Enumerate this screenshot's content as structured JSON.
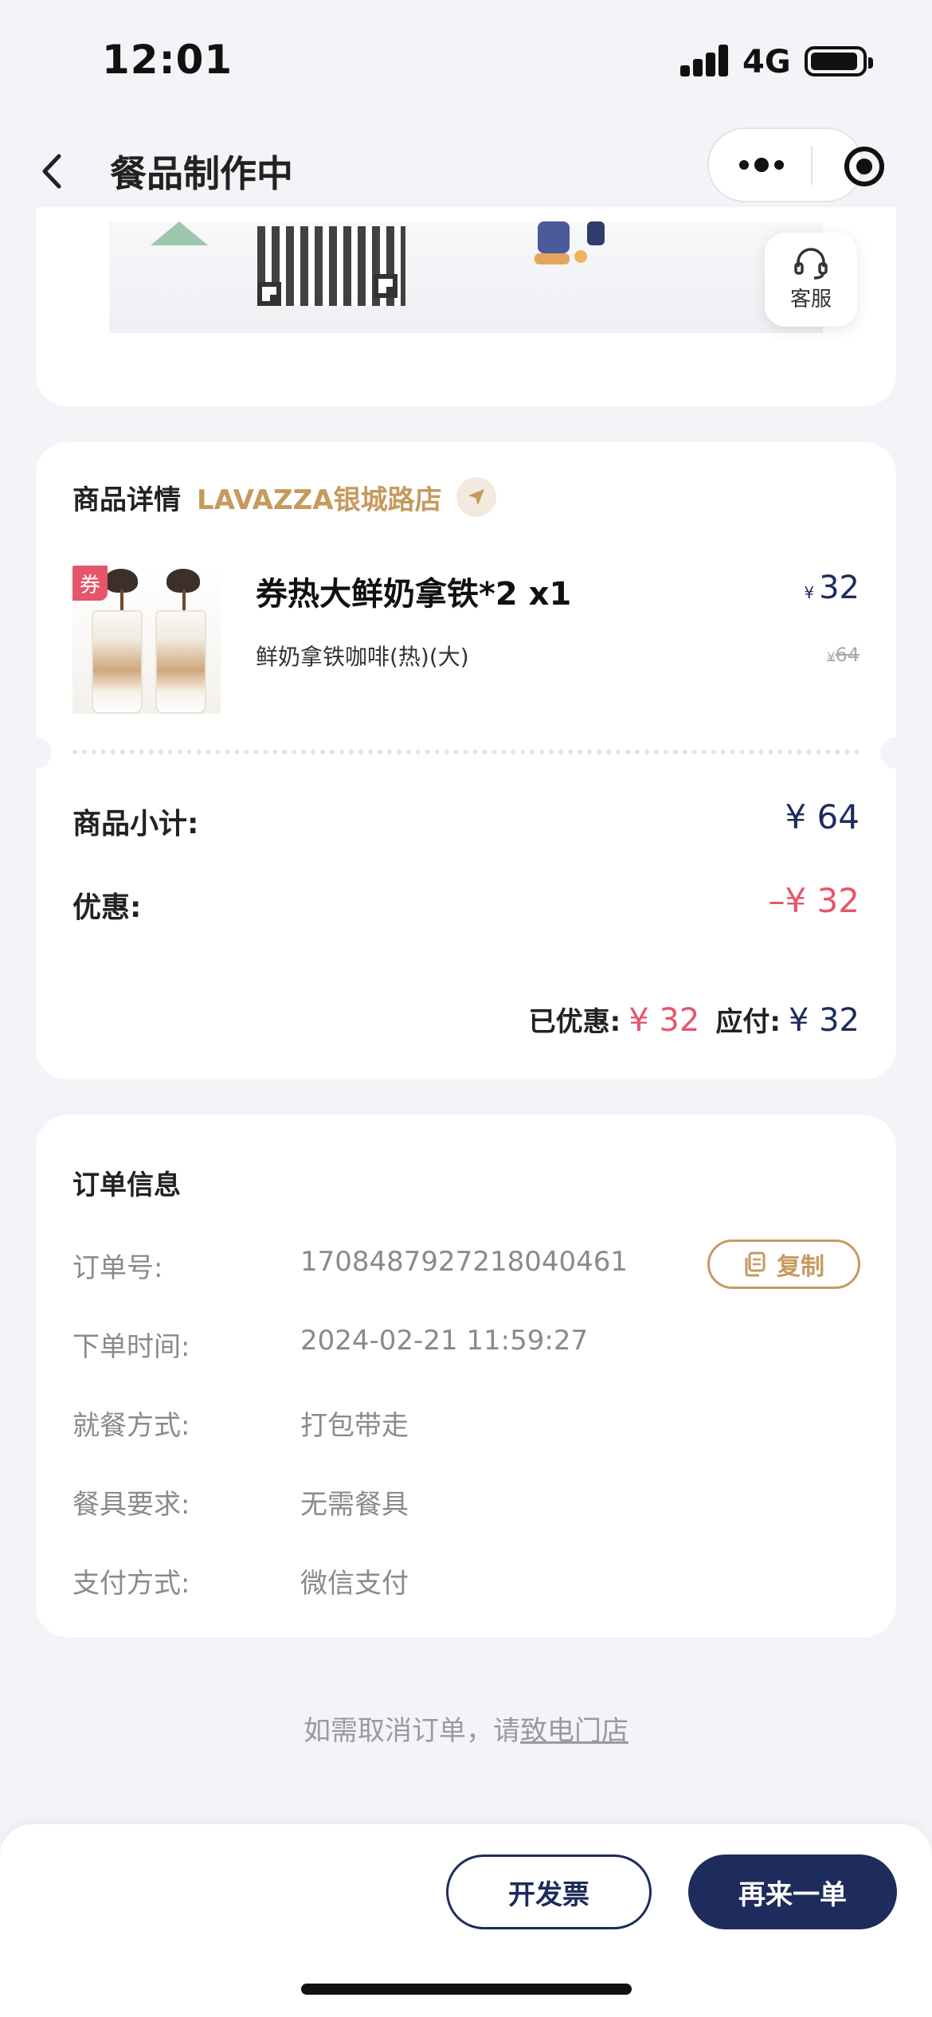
{
  "status_bar": {
    "time": "12:01",
    "network": "4G"
  },
  "nav": {
    "title": "餐品制作中"
  },
  "customer_service": {
    "label": "客服"
  },
  "detail": {
    "section_title": "商品详情",
    "store_name": "LAVAZZA银城路店",
    "product": {
      "coupon_tag": "券",
      "name": "券热大鲜奶拿铁*2 x1",
      "spec": "鲜奶拿铁咖啡(热)(大)",
      "currency": "¥",
      "price": "32",
      "original_price": "64"
    },
    "subtotal_label": "商品小计:",
    "subtotal_value": "¥ 64",
    "discount_label": "优惠:",
    "discount_value": "–¥ 32",
    "saved_label": "已优惠:",
    "saved_value": "¥ 32",
    "payable_label": "应付:",
    "payable_value": "¥ 32"
  },
  "order_info": {
    "title": "订单信息",
    "copy_label": "复制",
    "rows": [
      {
        "label": "订单号:",
        "value": "1708487927218040461"
      },
      {
        "label": "下单时间:",
        "value": "2024-02-21 11:59:27"
      },
      {
        "label": "就餐方式:",
        "value": "打包带走"
      },
      {
        "label": "餐具要求:",
        "value": "无需餐具"
      },
      {
        "label": "支付方式:",
        "value": "微信支付"
      }
    ]
  },
  "cancel_tip": {
    "text": "如需取消订单，请",
    "link": "致电门店"
  },
  "actions": {
    "invoice": "开发票",
    "reorder": "再来一单"
  },
  "colors": {
    "navy": "#1d2c5c",
    "gold": "#c69a5d",
    "red": "#e5566b"
  }
}
